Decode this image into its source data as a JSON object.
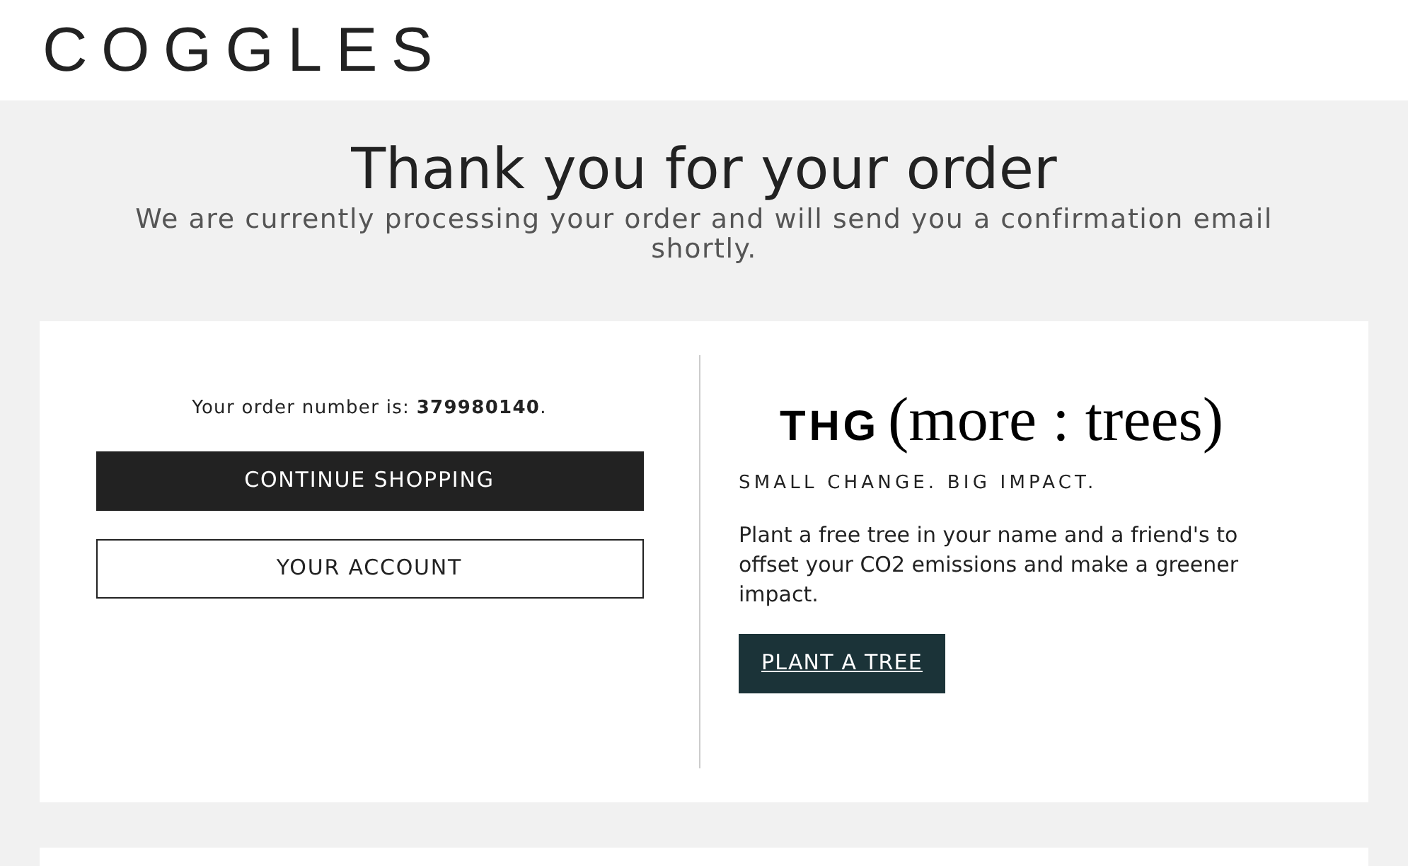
{
  "header": {
    "logo": "COGGLES"
  },
  "heading": {
    "title": "Thank you for your order",
    "subtitle": "We are currently processing your order and will send you a confirmation email shortly."
  },
  "order": {
    "number_text": "Your order number is: **379980140**.",
    "buttons": [
      {
        "label": "CONTINUE SHOPPING",
        "kind": "primary"
      },
      {
        "label": "YOUR ACCOUNT",
        "kind": "secondary"
      }
    ]
  },
  "promo": {
    "logo_brand": "THG",
    "logo_tagline": "(more : trees)",
    "slogan": "SMALL CHANGE. BIG IMPACT.",
    "text": "Plant a free tree in your name and a friend's to offset your CO2 emissions and make a greener impact.",
    "button": "PLANT A TREE"
  }
}
